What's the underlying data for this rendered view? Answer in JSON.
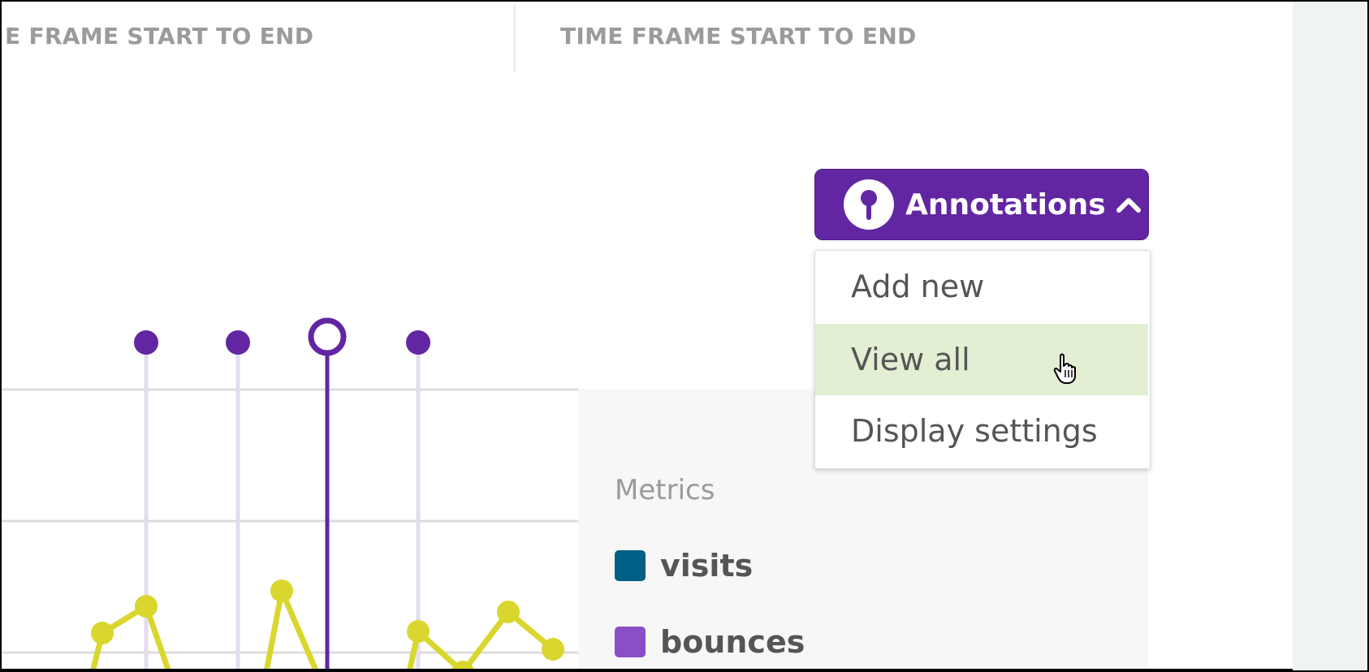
{
  "columns": {
    "left_header": "E FRAME START TO END",
    "right_header": "TIME FRAME START TO END"
  },
  "annotations_button": {
    "label": "Annotations",
    "icon": "pin-icon",
    "chevron_icon": "chevron-up-icon",
    "color": "#6326a2"
  },
  "annotations_menu": {
    "items": [
      {
        "label": "Add new"
      },
      {
        "label": "View all",
        "state": "hovered"
      },
      {
        "label": "Display settings"
      }
    ],
    "hover_color": "#e2efd3"
  },
  "legend": {
    "title": "Metrics",
    "items": [
      {
        "label": "visits",
        "color": "#005f84"
      },
      {
        "label": "bounces",
        "color": "#8a4fc7"
      }
    ]
  },
  "chart_data": {
    "type": "line",
    "series": [
      {
        "color": "#d9d62e",
        "values_note": "partially visible yellow line with point markers"
      }
    ],
    "annotation_markers": 4,
    "selected_annotation_index": 2,
    "annotation_color": "#6326a2",
    "grid": true
  }
}
